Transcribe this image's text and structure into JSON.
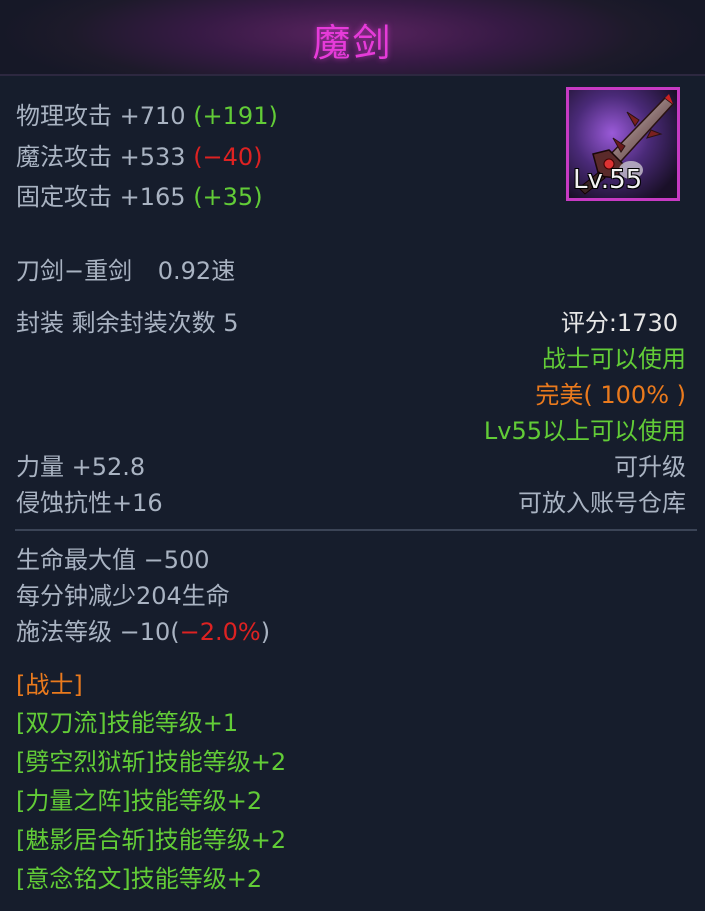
{
  "item": {
    "name": "魔剑",
    "level_badge": "Lv.55",
    "attack": [
      {
        "label": "物理攻击 +710",
        "bonus": "(+191)",
        "bonus_color": "#62cc37"
      },
      {
        "label": "魔法攻击 +533",
        "bonus": "(−40)",
        "bonus_color": "#dd2222"
      },
      {
        "label": "固定攻击 +165",
        "bonus": "(+35)",
        "bonus_color": "#62cc37"
      }
    ],
    "weapon_type": "刀剑−重剑",
    "speed": "0.92速",
    "seal": "封装 剩余封装次数 5",
    "score": "评分:1730",
    "class_usable": "战士可以使用",
    "quality": "完美( 100% )",
    "level_req": "Lv55以上可以使用",
    "strength": "力量 +52.8",
    "upgradable": "可升级",
    "corrosion_res": "侵蚀抗性+16",
    "account_storage": "可放入账号仓库",
    "hp_max": "生命最大值 −500",
    "hp_drain": "每分钟减少204生命",
    "cast_level": "施法等级 −10(",
    "cast_pct": "−2.0%",
    "cast_close": ")",
    "class_tag": "[战士]",
    "skills": [
      "[双刀流]技能等级+1",
      "[劈空烈狱斩]技能等级+2",
      "[力量之阵]技能等级+2",
      "[魅影居合斩]技能等级+2",
      "[意念铭文]技能等级+2"
    ]
  },
  "colors": {
    "title": "#e63bd9",
    "text": "#a9b3c2",
    "green": "#62cc37",
    "red": "#dd2222",
    "orange": "#ea7a1d",
    "background": "#161d2c"
  },
  "icon_name": "demon-sword-icon"
}
